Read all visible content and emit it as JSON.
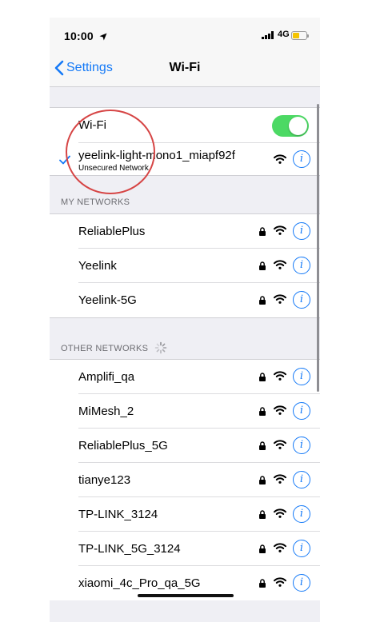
{
  "status": {
    "time": "10:00",
    "network": "4G"
  },
  "nav": {
    "back_label": "Settings",
    "title": "Wi-Fi"
  },
  "wifi_toggle": {
    "label": "Wi-Fi",
    "on": true
  },
  "current": {
    "name": "yeelink-light-mono1_miapf92f",
    "subtitle": "Unsecured Network"
  },
  "my_networks": {
    "header": "MY NETWORKS",
    "items": [
      {
        "name": "ReliablePlus"
      },
      {
        "name": "Yeelink"
      },
      {
        "name": "Yeelink-5G"
      }
    ]
  },
  "other_networks": {
    "header": "OTHER NETWORKS",
    "items": [
      {
        "name": "Amplifi_qa"
      },
      {
        "name": "MiMesh_2"
      },
      {
        "name": "ReliablePlus_5G"
      },
      {
        "name": "tianye123"
      },
      {
        "name": "TP-LINK_3124"
      },
      {
        "name": "TP-LINK_5G_3124"
      },
      {
        "name": "xiaomi_4c_Pro_qa_5G"
      }
    ]
  },
  "icons": {
    "info_glyph": "i"
  },
  "colors": {
    "accent": "#1479f7",
    "toggle_on": "#4cd964",
    "annotation": "#d64545"
  }
}
